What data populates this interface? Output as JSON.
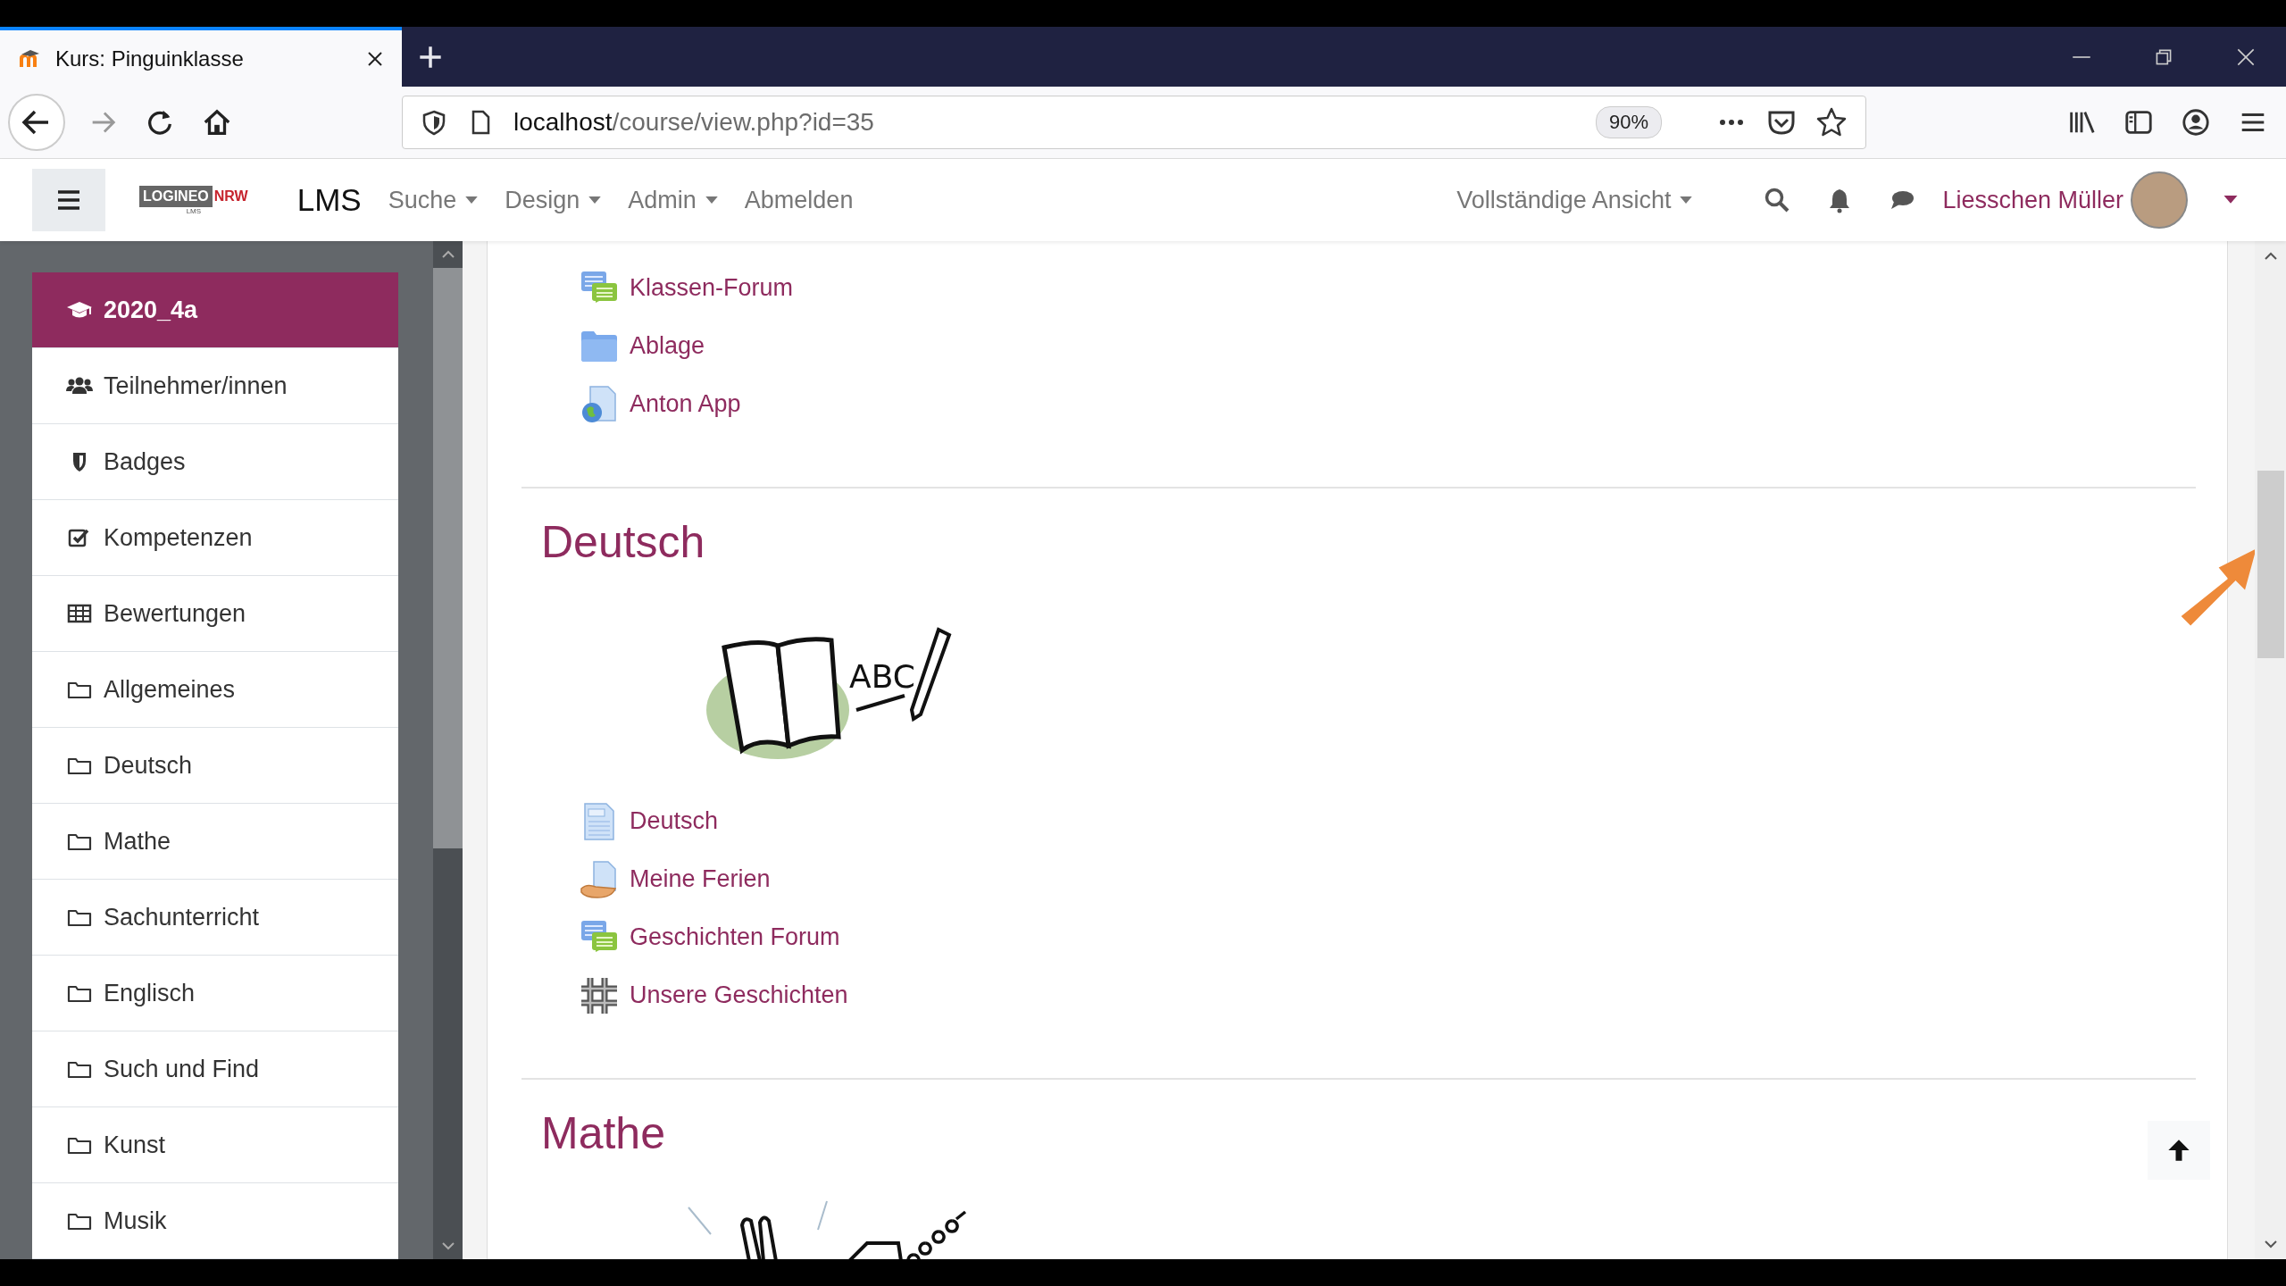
{
  "browser": {
    "tab_title": "Kurs: Pinguinklasse",
    "url_host": "localhost",
    "url_path": "/course/view.php?id=35",
    "zoom": "90%"
  },
  "navbar": {
    "logo": {
      "main": "LOGINEO",
      "accent": "NRW",
      "sub": "LMS"
    },
    "brand": "LMS",
    "menus": [
      {
        "label": "Suche",
        "kind": "dropdown"
      },
      {
        "label": "Design",
        "kind": "dropdown"
      },
      {
        "label": "Admin",
        "kind": "dropdown"
      },
      {
        "label": "Abmelden",
        "kind": "link"
      }
    ],
    "view_mode": "Vollständige Ansicht",
    "user": "Liesschen Müller"
  },
  "sidebar": {
    "items": [
      {
        "label": "2020_4a",
        "kind": "course",
        "selected": true
      },
      {
        "label": "Teilnehmer/innen",
        "kind": "participants",
        "selected": false
      },
      {
        "label": "Badges",
        "kind": "badges",
        "selected": false
      },
      {
        "label": "Kompetenzen",
        "kind": "competencies",
        "selected": false
      },
      {
        "label": "Bewertungen",
        "kind": "grades",
        "selected": false
      },
      {
        "label": "Allgemeines",
        "kind": "section",
        "selected": false
      },
      {
        "label": "Deutsch",
        "kind": "section",
        "selected": false
      },
      {
        "label": "Mathe",
        "kind": "section",
        "selected": false
      },
      {
        "label": "Sachunterricht",
        "kind": "section",
        "selected": false
      },
      {
        "label": "Englisch",
        "kind": "section",
        "selected": false
      },
      {
        "label": "Such und Find",
        "kind": "section",
        "selected": false
      },
      {
        "label": "Kunst",
        "kind": "section",
        "selected": false
      },
      {
        "label": "Musik",
        "kind": "section",
        "selected": false
      }
    ]
  },
  "sections": [
    {
      "activities": [
        {
          "label": "Klassen-Forum",
          "kind": "forum"
        },
        {
          "label": "Ablage",
          "kind": "folder"
        },
        {
          "label": "Anton App",
          "kind": "url"
        }
      ]
    },
    {
      "title": "Deutsch",
      "image_text": "ABC",
      "activities": [
        {
          "label": "Deutsch",
          "kind": "page"
        },
        {
          "label": "Meine Ferien",
          "kind": "assign"
        },
        {
          "label": "Geschichten Forum",
          "kind": "forum"
        },
        {
          "label": "Unsere Geschichten",
          "kind": "wiki"
        }
      ]
    },
    {
      "title": "Mathe"
    }
  ]
}
